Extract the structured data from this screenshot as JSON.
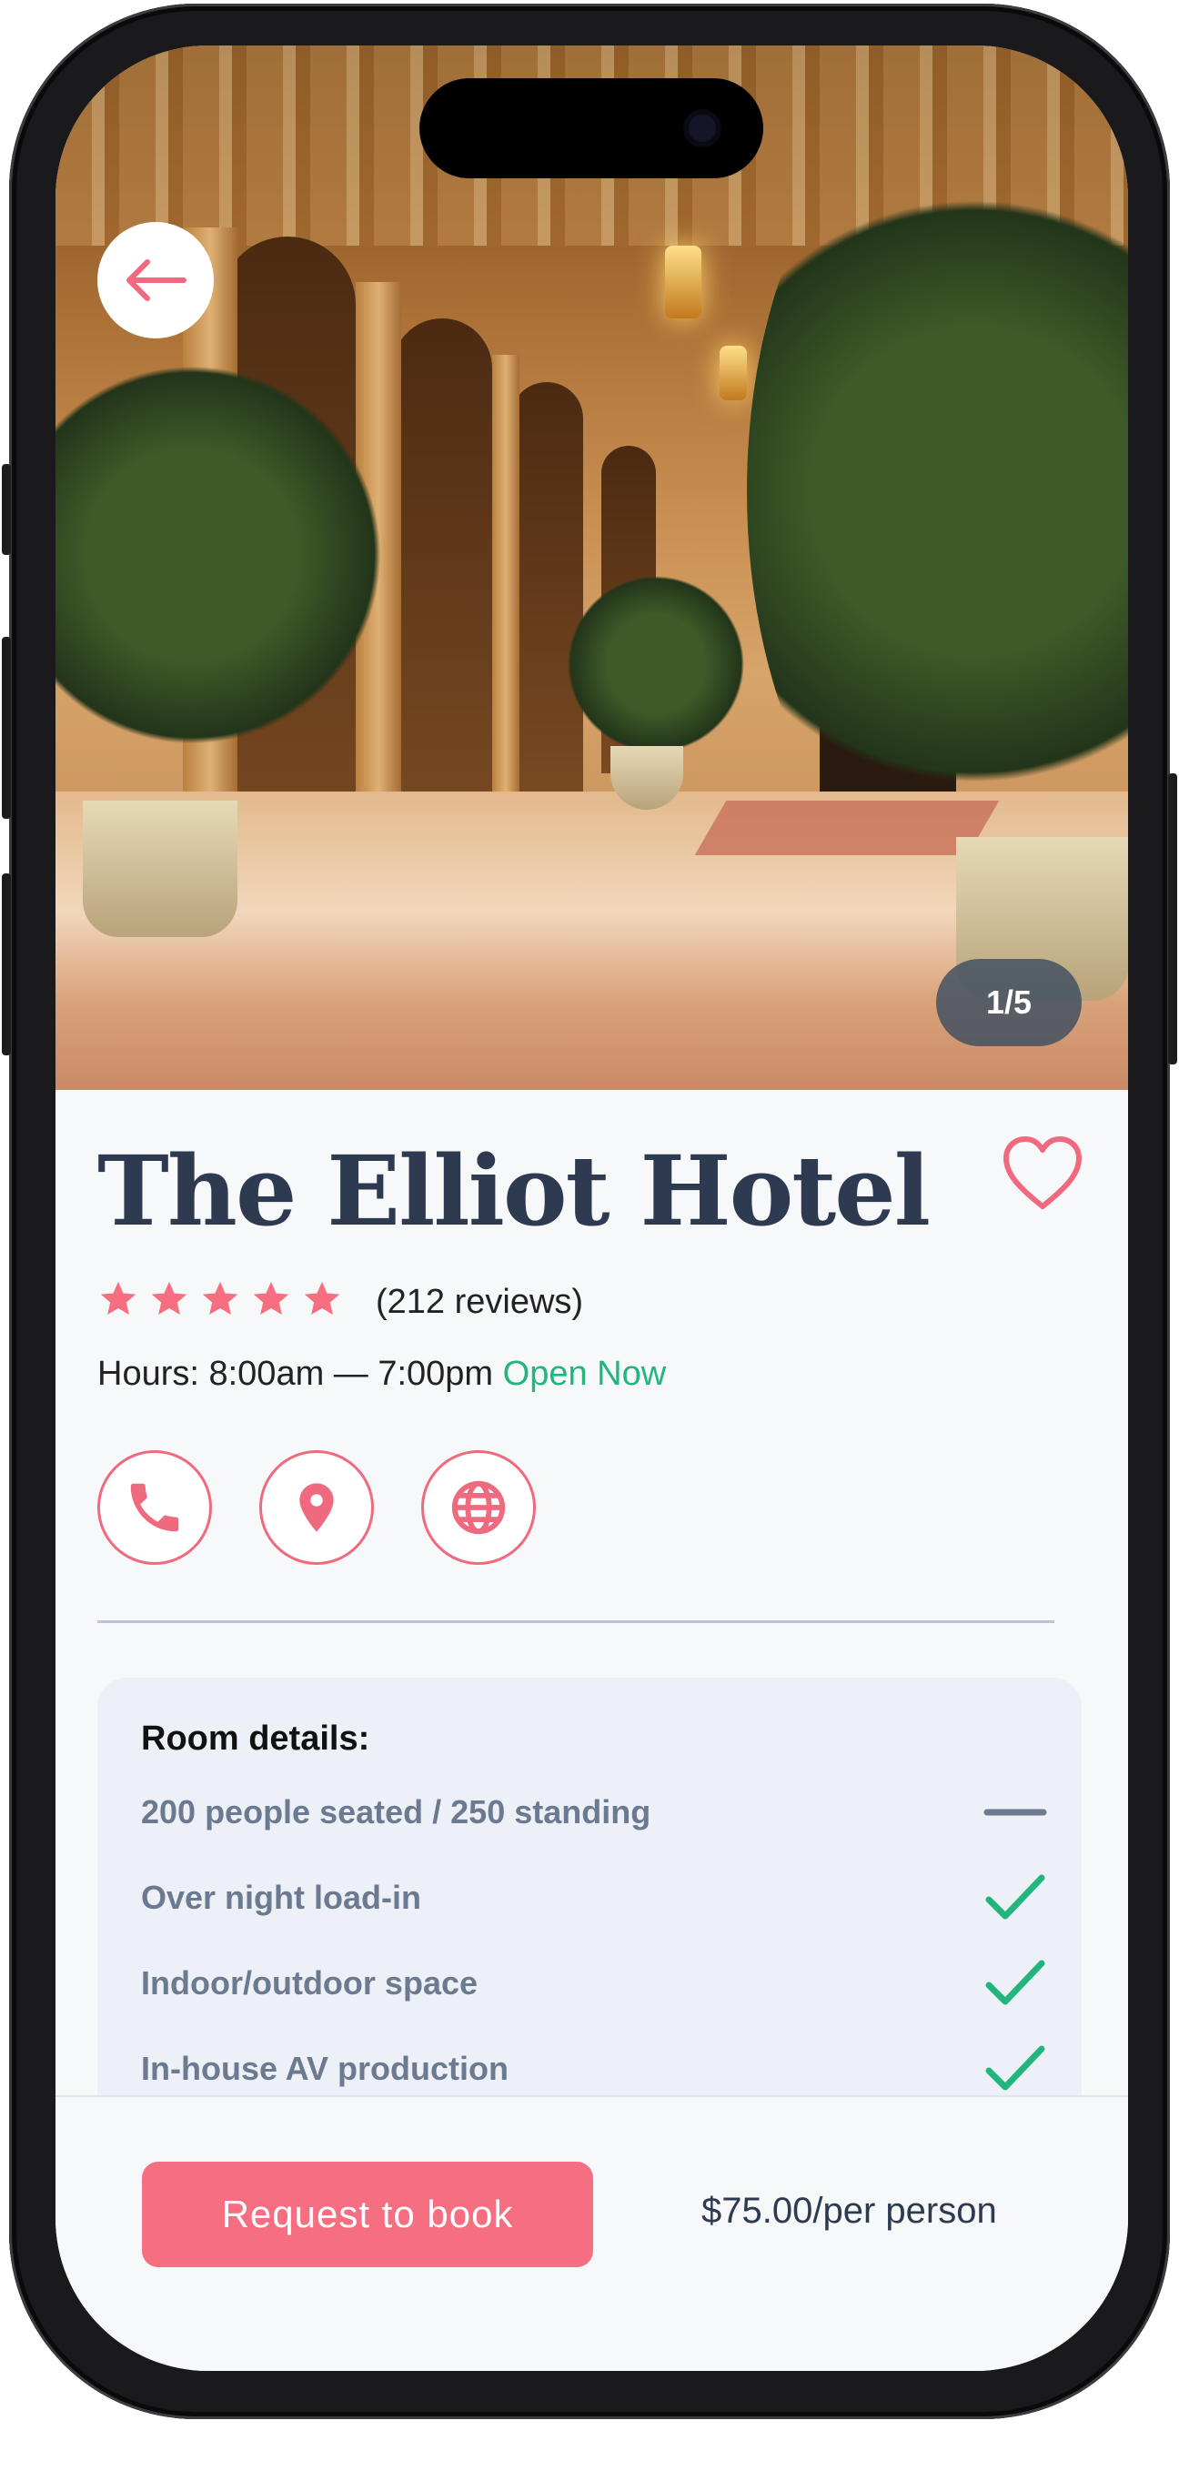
{
  "gallery": {
    "counter": "1/5"
  },
  "hotel": {
    "name": "The Elliot Hotel",
    "rating_stars": 5,
    "reviews": "(212 reviews)",
    "hours_label": "Hours: 8:00am — 7:00pm",
    "status": "Open Now"
  },
  "actions": {
    "phone_icon": "phone-icon",
    "location_icon": "map-pin-icon",
    "web_icon": "globe-icon"
  },
  "room_details": {
    "title": "Room details:",
    "items": [
      {
        "label": "200 people seated / 250 standing",
        "mark": "dash"
      },
      {
        "label": "Over night load-in",
        "mark": "check"
      },
      {
        "label": "Indoor/outdoor space",
        "mark": "check"
      },
      {
        "label": "In-house AV production",
        "mark": "check"
      }
    ]
  },
  "booking": {
    "cta": "Request to book",
    "price": "$75.00/per person"
  },
  "colors": {
    "accent": "#f66f81",
    "open": "#22b67e",
    "title": "#2d3a50"
  }
}
